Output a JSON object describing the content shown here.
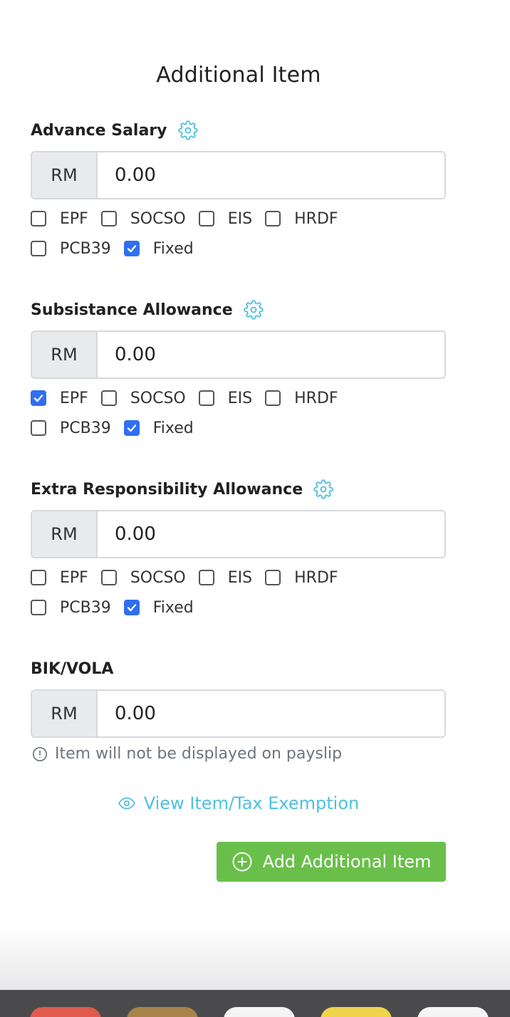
{
  "panel": {
    "title": "Additional Item"
  },
  "currency_prefix": "RM",
  "items": [
    {
      "label": "Advance Salary",
      "amount": "0.00",
      "has_settings": true,
      "options": [
        {
          "label": "EPF",
          "checked": false
        },
        {
          "label": "SOCSO",
          "checked": false
        },
        {
          "label": "EIS",
          "checked": false
        },
        {
          "label": "HRDF",
          "checked": false
        },
        {
          "label": "PCB39",
          "checked": false
        },
        {
          "label": "Fixed",
          "checked": true
        }
      ]
    },
    {
      "label": "Subsistance Allowance",
      "amount": "0.00",
      "has_settings": true,
      "options": [
        {
          "label": "EPF",
          "checked": true
        },
        {
          "label": "SOCSO",
          "checked": false
        },
        {
          "label": "EIS",
          "checked": false
        },
        {
          "label": "HRDF",
          "checked": false
        },
        {
          "label": "PCB39",
          "checked": false
        },
        {
          "label": "Fixed",
          "checked": true
        }
      ]
    },
    {
      "label": "Extra Responsibility Allowance",
      "amount": "0.00",
      "has_settings": true,
      "options": [
        {
          "label": "EPF",
          "checked": false
        },
        {
          "label": "SOCSO",
          "checked": false
        },
        {
          "label": "EIS",
          "checked": false
        },
        {
          "label": "HRDF",
          "checked": false
        },
        {
          "label": "PCB39",
          "checked": false
        },
        {
          "label": "Fixed",
          "checked": true
        }
      ]
    },
    {
      "label": "BIK/VOLA",
      "amount": "0.00",
      "has_settings": false,
      "note": "Item will not be displayed on payslip"
    }
  ],
  "links": {
    "view_exemption": "View Item/Tax Exemption"
  },
  "buttons": {
    "add_item": "Add Additional Item"
  },
  "colors": {
    "accent_link": "#4fc0e0",
    "checkbox_checked": "#2f6ff0",
    "add_button": "#6abf4b"
  },
  "icons": {
    "settings": "gear-icon",
    "info": "info-circle-icon",
    "view": "eye-icon",
    "add": "plus-circle-icon",
    "check": "check-icon"
  }
}
